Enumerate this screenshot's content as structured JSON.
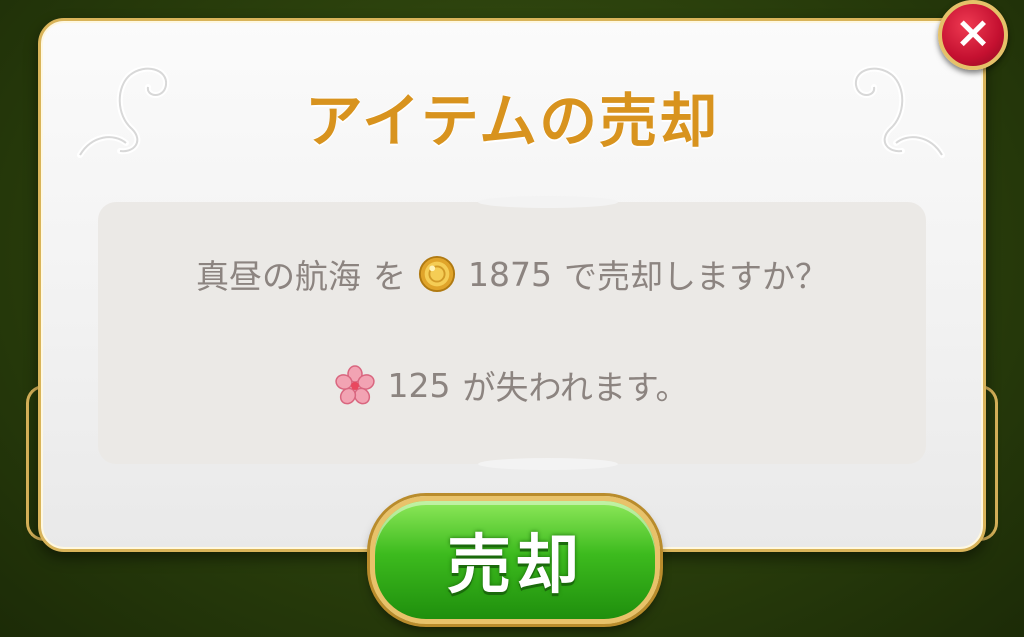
{
  "dialog": {
    "title": "アイテムの売却",
    "message": {
      "item_name": "真昼の航海",
      "particle": "を",
      "coin_amount": "1875",
      "question": "で売却しますか？",
      "flower_amount": "125",
      "loss_text": "が失われます。"
    },
    "sell_button_label": "売却",
    "close_button_label": "×"
  },
  "icons": {
    "coin": "coin-icon",
    "flower": "flower-icon",
    "close": "close-icon"
  },
  "colors": {
    "title": "#d8931e",
    "message_text": "#8c8480",
    "gold_border": "#d9b45a",
    "sell_button": "#3dbb1e",
    "close_button": "#c41030"
  }
}
